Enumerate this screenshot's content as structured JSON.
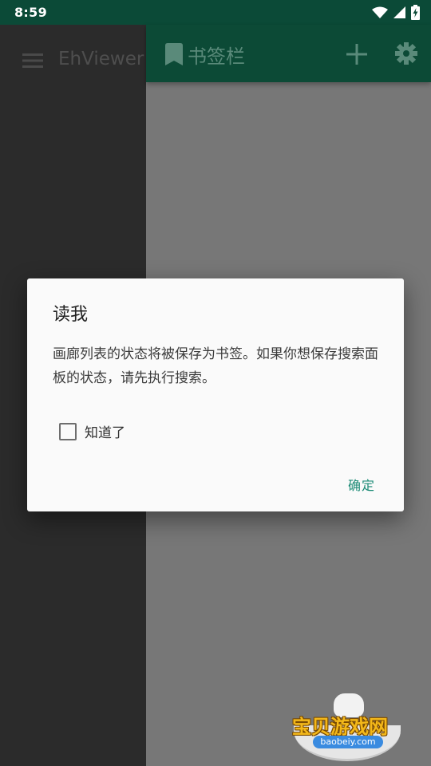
{
  "status_bar": {
    "time": "8:59",
    "icons": [
      "wifi-icon",
      "cell-signal-icon",
      "battery-charging-icon"
    ]
  },
  "main_screen": {
    "title": "EhViewer",
    "menu_icon": "hamburger-menu-icon"
  },
  "drawer": {
    "title": "书签栏",
    "icons": [
      "bookmark-icon",
      "add-icon",
      "settings-icon"
    ]
  },
  "dialog": {
    "title": "读我",
    "message": "画廊列表的状态将被保存为书签。如果你想保存搜索面板的状态，请先执行搜索。",
    "checkbox_label": "知道了",
    "checkbox_checked": false,
    "ok_label": "确定"
  },
  "watermark": {
    "text": "宝贝游戏网",
    "url": "baobeiy.com"
  },
  "colors": {
    "status_bar": "#0b4a37",
    "toolbar": "#0c4a36",
    "accent": "#1a8a75",
    "dialog_bg": "#fafafa",
    "scrim": "#777777"
  }
}
